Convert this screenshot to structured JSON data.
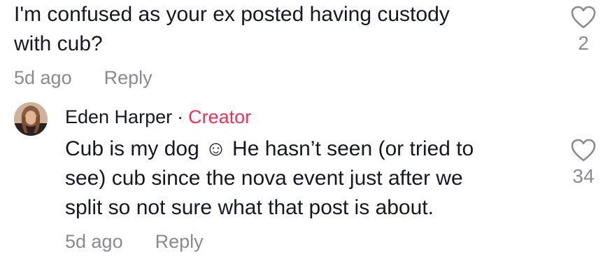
{
  "comment": {
    "text": "I'm confused as your ex posted having custody\nwith cub?",
    "time": "5d ago",
    "reply_label": "Reply",
    "like_count": "2",
    "like_icon": "heart-outline-icon"
  },
  "reply": {
    "author": "Eden Harper",
    "separator": "·",
    "badge": "Creator",
    "text": "Cub is my dog ☺ He hasn’t seen (or tried to\nsee) cub since the nova event just after we\nsplit so not sure what that post is about.",
    "time": "5d ago",
    "reply_label": "Reply",
    "like_count": "34",
    "like_icon": "heart-outline-icon"
  },
  "colors": {
    "text": "#161823",
    "muted": "#8a8b91",
    "creator": "#fe2c55"
  }
}
